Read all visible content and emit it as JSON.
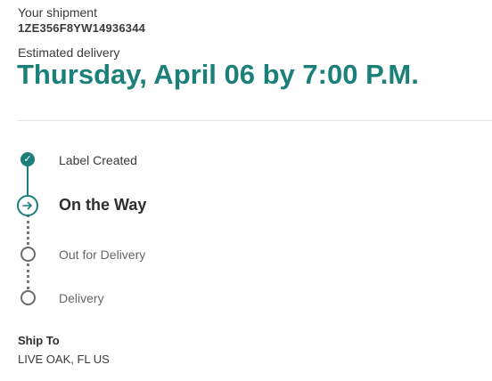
{
  "shipment": {
    "label": "Your shipment",
    "tracking_number": "1ZE356F8YW14936344"
  },
  "estimated": {
    "label": "Estimated delivery",
    "date": "Thursday, April 06 by 7:00 P.M."
  },
  "timeline": {
    "steps": [
      {
        "label": "Label Created",
        "status": "complete",
        "icon": "check-icon"
      },
      {
        "label": "On the Way",
        "status": "current",
        "icon": "arrow-right-icon"
      },
      {
        "label": "Out for Delivery",
        "status": "pending",
        "icon": "empty-circle-icon"
      },
      {
        "label": "Delivery",
        "status": "pending",
        "icon": "empty-circle-icon"
      }
    ]
  },
  "ship_to": {
    "label": "Ship To",
    "value": "LIVE OAK, FL US"
  },
  "colors": {
    "accent": "#1b7f7a",
    "pending": "#6b6b6b"
  }
}
